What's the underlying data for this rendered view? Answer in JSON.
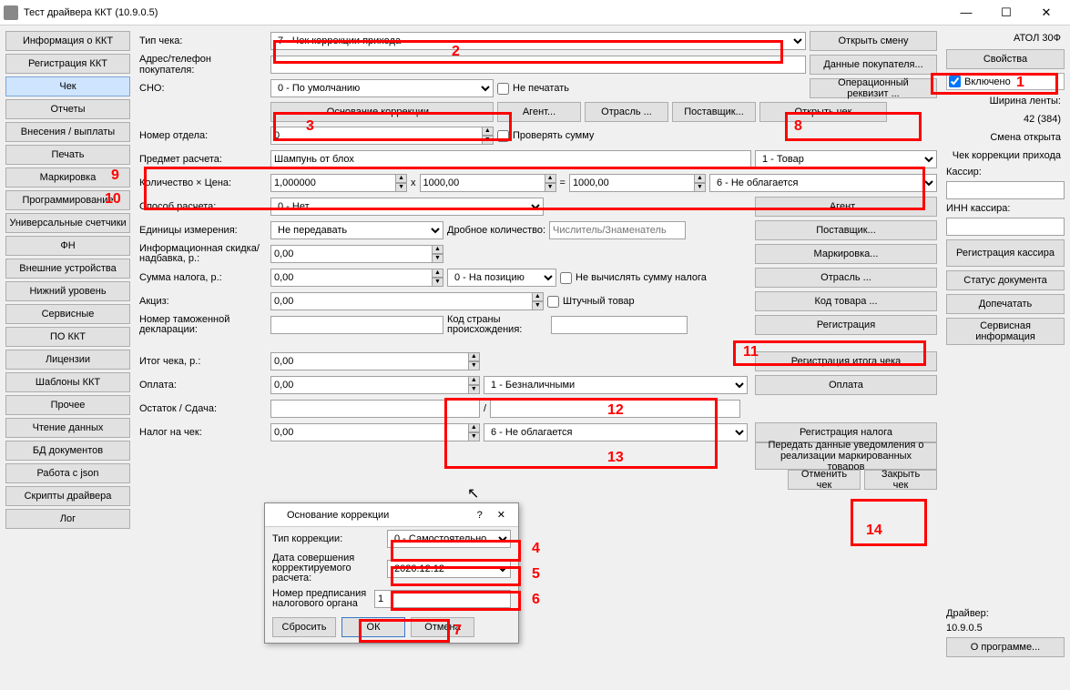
{
  "window": {
    "title": "Тест драйвера ККТ (10.9.0.5)",
    "min": "—",
    "max": "☐",
    "close": "✕"
  },
  "nav": {
    "items": [
      "Информация о ККТ",
      "Регистрация ККТ",
      "Чек",
      "Отчеты",
      "Внесения / выплаты",
      "Печать",
      "Маркировка",
      "Программирование",
      "Универсальные счетчики",
      "ФН",
      "Внешние устройства",
      "Нижний уровень",
      "Сервисные",
      "ПО ККТ",
      "Лицензии",
      "Шаблоны ККТ",
      "Прочее",
      "Чтение данных",
      "БД документов",
      "Работа с json",
      "Скрипты драйвера",
      "Лог"
    ],
    "active": 2
  },
  "labels": {
    "chequetype": "Тип чека:",
    "buyer": "Адрес/телефон покупателя:",
    "sno": "СНО:",
    "noprint": "Не печатать",
    "deptno": "Номер отдела:",
    "checksum": "Проверять сумму",
    "subject": "Предмет расчета:",
    "qtyprice": "Количество × Цена:",
    "eq": "=",
    "x": "x",
    "paymethod": "Способ расчета:",
    "unit": "Единицы измерения:",
    "fracqty": "Дробное количество:",
    "fracph": "Числитель/Знаменатель",
    "infodisc": "Информационная скидка/надбавка, р.:",
    "taxsum": "Сумма налога, р.:",
    "taxpos": "0 - На позицию",
    "nocalc": "Не вычислять сумму налога",
    "excise": "Акциз:",
    "piece": "Штучный товар",
    "customs": "Номер таможенной декларации:",
    "originctry": "Код страны происхождения:",
    "total": "Итог чека, р.:",
    "pay": "Оплата:",
    "change": "Остаток / Сдача:",
    "slash": "/",
    "taxcheque": "Налог на чек:"
  },
  "values": {
    "chequetype": "7 - Чек коррекции прихода",
    "sno": "0 - По умолчанию",
    "deptno": "0",
    "subject": "Шампунь от блох",
    "subjtype": "1 - Товар",
    "qty": "1,000000",
    "price": "1000,00",
    "amount": "1000,00",
    "vat": "6 - Не облагается",
    "paymethod": "0 - Нет",
    "unit": "Не передавать",
    "infodisc": "0,00",
    "taxsum": "0,00",
    "excise": "0,00",
    "total": "0,00",
    "pay": "0,00",
    "paytype": "1 - Безналичными",
    "taxcheque": "0,00",
    "taxchtype": "6 - Не облагается"
  },
  "btns": {
    "openshift": "Открыть смену",
    "buyerdata": "Данные покупателя...",
    "opreq": "Операционный реквизит ...",
    "corrbase": "Основание коррекции...",
    "agent": "Агент...",
    "industry": "Отрасль ...",
    "supplier": "Поставщик...",
    "opencheque": "Открыть чек",
    "agent2": "Агент...",
    "supplier2": "Поставщик...",
    "marking": "Маркировка...",
    "industry2": "Отрасль ...",
    "goodscode": "Код товара ...",
    "register": "Регистрация",
    "regtotal": "Регистрация итога чека",
    "paybtn": "Оплата",
    "regtax": "Регистрация налога",
    "senddata": "Передать данные уведомления о реализации маркированных товаров",
    "cancel": "Отменить чек",
    "close": "Закрыть чек"
  },
  "right": {
    "model": "АТОЛ 30Ф",
    "props": "Свойства",
    "enabled": "Включено",
    "tapewidth": "Ширина ленты:",
    "tapeval": "42 (384)",
    "shiftopen": "Смена открыта",
    "chequecorr": "Чек коррекции прихода",
    "cashier": "Кассир:",
    "inncashier": "ИНН кассира:",
    "regcashier": "Регистрация кассира",
    "docstatus": "Статус документа",
    "reprint": "Допечатать",
    "service": "Сервисная информация",
    "driver": "Драйвер:",
    "driverver": "10.9.0.5",
    "about": "О программе..."
  },
  "dialog": {
    "title": "Основание коррекции",
    "help": "?",
    "close": "✕",
    "corrtype_l": "Тип коррекции:",
    "corrtype_v": "0 - Самостоятельно",
    "date_l": "Дата совершения корректируемого расчета:",
    "date_v": "2020.12.12",
    "order_l": "Номер предписания налогового органа",
    "order_v": "1",
    "reset": "Сбросить",
    "ok": "ОК",
    "cancel": "Отмена"
  },
  "annot": {
    "n1": "1",
    "n2": "2",
    "n3": "3",
    "n4": "4",
    "n5": "5",
    "n6": "6",
    "n7": "7",
    "n8": "8",
    "n9": "9",
    "n10": "10",
    "n11": "11",
    "n12": "12",
    "n13": "13",
    "n14": "14"
  }
}
